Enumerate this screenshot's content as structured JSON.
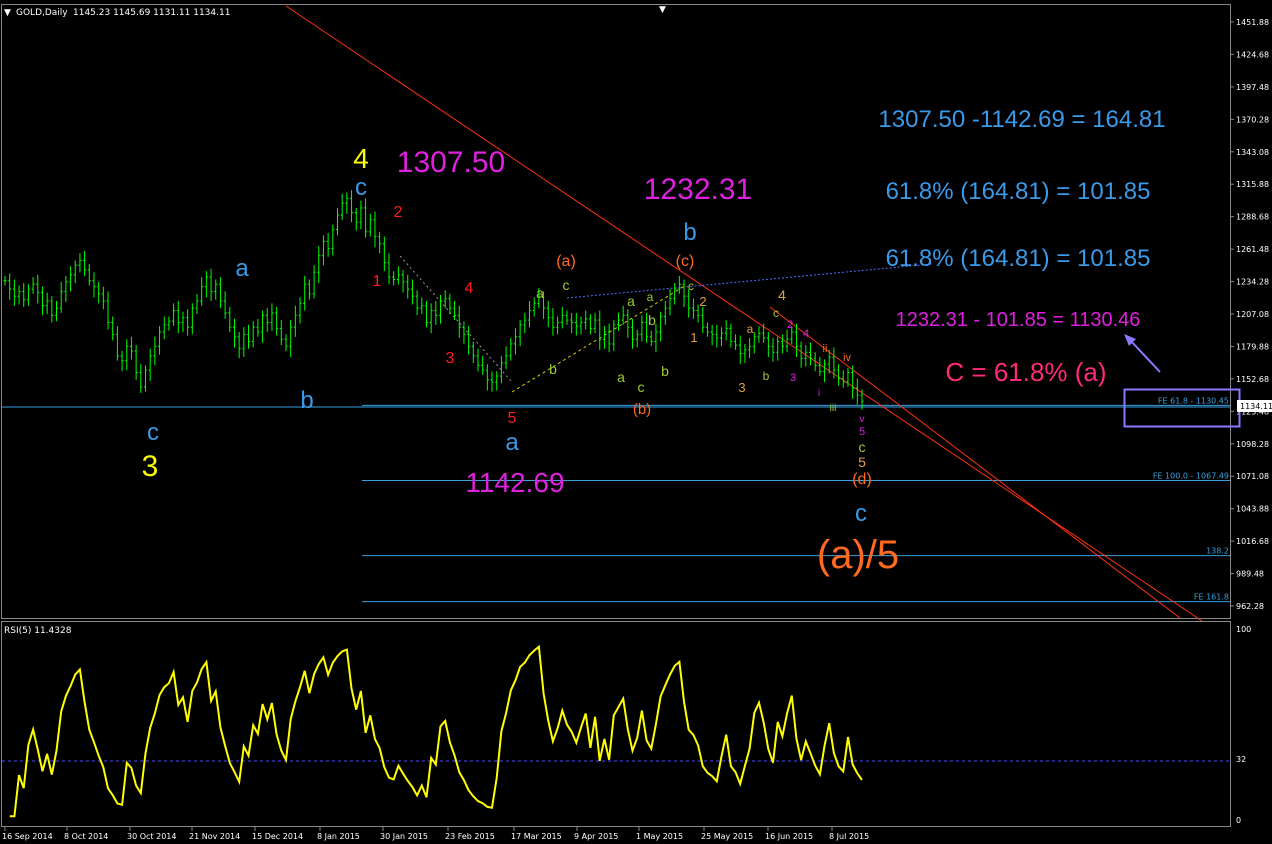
{
  "header": {
    "collapse_glyph": "▼",
    "symbol": "GOLD,Daily",
    "ohlc": "1145.23 1145.69 1131.11 1134.11",
    "scroll_glyph": "▼"
  },
  "chart_data": [
    {
      "type": "candlestick",
      "symbol": "GOLD",
      "timeframe": "Daily",
      "ylim": [
        955,
        1460
      ],
      "price_ticks": [
        "1451.88",
        "1424.68",
        "1397.48",
        "1370.28",
        "1343.08",
        "1315.88",
        "1288.68",
        "1261.48",
        "1234.28",
        "1207.08",
        "1179.88",
        "1152.68",
        "1125.48",
        "1098.28",
        "1071.08",
        "1043.88",
        "1016.68",
        "989.48",
        "962.28"
      ],
      "current_price": "1134.11",
      "date_ticks": [
        "16 Sep 2014",
        "8 Oct 2014",
        "30 Oct 2014",
        "21 Nov 2014",
        "15 Dec 2014",
        "8 Jan 2015",
        "30 Jan 2015",
        "23 Feb 2015",
        "17 Mar 2015",
        "9 Apr 2015",
        "1 May 2015",
        "25 May 2015",
        "16 Jun 2015",
        "8 Jul 2015"
      ],
      "closes": [
        1235,
        1228,
        1222,
        1226,
        1219,
        1228,
        1232,
        1225,
        1214,
        1218,
        1206,
        1212,
        1226,
        1234,
        1240,
        1248,
        1252,
        1244,
        1235,
        1230,
        1224,
        1218,
        1200,
        1190,
        1172,
        1168,
        1180,
        1176,
        1158,
        1146,
        1160,
        1172,
        1180,
        1192,
        1198,
        1201,
        1210,
        1200,
        1204,
        1196,
        1212,
        1218,
        1230,
        1238,
        1226,
        1232,
        1218,
        1208,
        1196,
        1188,
        1178,
        1190,
        1184,
        1196,
        1192,
        1206,
        1200,
        1208,
        1195,
        1186,
        1180,
        1196,
        1206,
        1216,
        1232,
        1224,
        1242,
        1256,
        1268,
        1262,
        1278,
        1290,
        1300,
        1304,
        1292,
        1284,
        1296,
        1276,
        1286,
        1272,
        1266,
        1250,
        1238,
        1236,
        1240,
        1234,
        1228,
        1222,
        1212,
        1214,
        1200,
        1210,
        1206,
        1218,
        1220,
        1212,
        1206,
        1196,
        1190,
        1180,
        1172,
        1164,
        1160,
        1152,
        1150,
        1155,
        1166,
        1172,
        1182,
        1188,
        1198,
        1202,
        1210,
        1216,
        1222,
        1212,
        1204,
        1196,
        1200,
        1206,
        1202,
        1200,
        1197,
        1200,
        1203,
        1195,
        1202,
        1186,
        1192,
        1182,
        1198,
        1202,
        1206,
        1196,
        1186,
        1190,
        1200,
        1188,
        1184,
        1192,
        1205,
        1212,
        1220,
        1228,
        1232,
        1222,
        1212,
        1210,
        1206,
        1196,
        1192,
        1190,
        1187,
        1191,
        1195,
        1184,
        1181,
        1174,
        1177,
        1180,
        1188,
        1191,
        1187,
        1180,
        1175,
        1184,
        1180,
        1186,
        1192,
        1180,
        1170,
        1175,
        1170,
        1164,
        1159,
        1165,
        1171,
        1160,
        1153,
        1150,
        1158,
        1145,
        1139,
        1134
      ],
      "wave_labels": [
        "c",
        "3",
        "a",
        "b",
        "4",
        "c",
        "1307.50",
        "2",
        "1",
        "4",
        "3",
        "5",
        "a",
        "1142.69",
        "(a)",
        "a",
        "c",
        "b",
        "a",
        "b",
        "a",
        "c",
        "(b)",
        "a",
        "c",
        "b",
        "1232.31",
        "b",
        "(c)",
        "2",
        "1",
        "4",
        "3",
        "a",
        "b",
        "c",
        "2",
        "4",
        "3",
        "i",
        "ii",
        "iii",
        "iv",
        "v",
        "5",
        "c",
        "5",
        "(d)",
        "c",
        "(a)/5"
      ],
      "calculations": [
        "1307.50 -1142.69 = 164.81",
        "61.8% (164.81) = 101.85",
        "61.8% (164.81) = 101.85",
        "1232.31 - 101.85 = 1130.46",
        "C = 61.8% (a)"
      ],
      "fibonacci_expansion": [
        {
          "label": "FE 61.8 - 1130.45",
          "price": 1130.45
        },
        {
          "label": "FE 100.0 - 1067.49",
          "price": 1067.49
        },
        {
          "label": "138.2",
          "price": 1004.5
        },
        {
          "label": "FE 161.8",
          "price": 966
        }
      ]
    },
    {
      "type": "line",
      "title": "RSI(5) 11.4328",
      "ylim": [
        0,
        100
      ],
      "level_ticks": [
        "100",
        "32",
        "0"
      ],
      "level_line": 32
    }
  ],
  "colors": {
    "candle": "#00ff00",
    "rsi_line": "#ffff00",
    "trendline": "#ff3010",
    "fib_line": "#3aa0e0",
    "magenta": "#e020e0",
    "blue": "#3a9ae8",
    "yellow": "#ffff00",
    "red": "#ff1a1a",
    "orange": "#ff6a20",
    "olive": "#9acd32",
    "tan": "#e0a040",
    "pink": "#ff2a7a",
    "highlight_box": "#8a7aff"
  }
}
